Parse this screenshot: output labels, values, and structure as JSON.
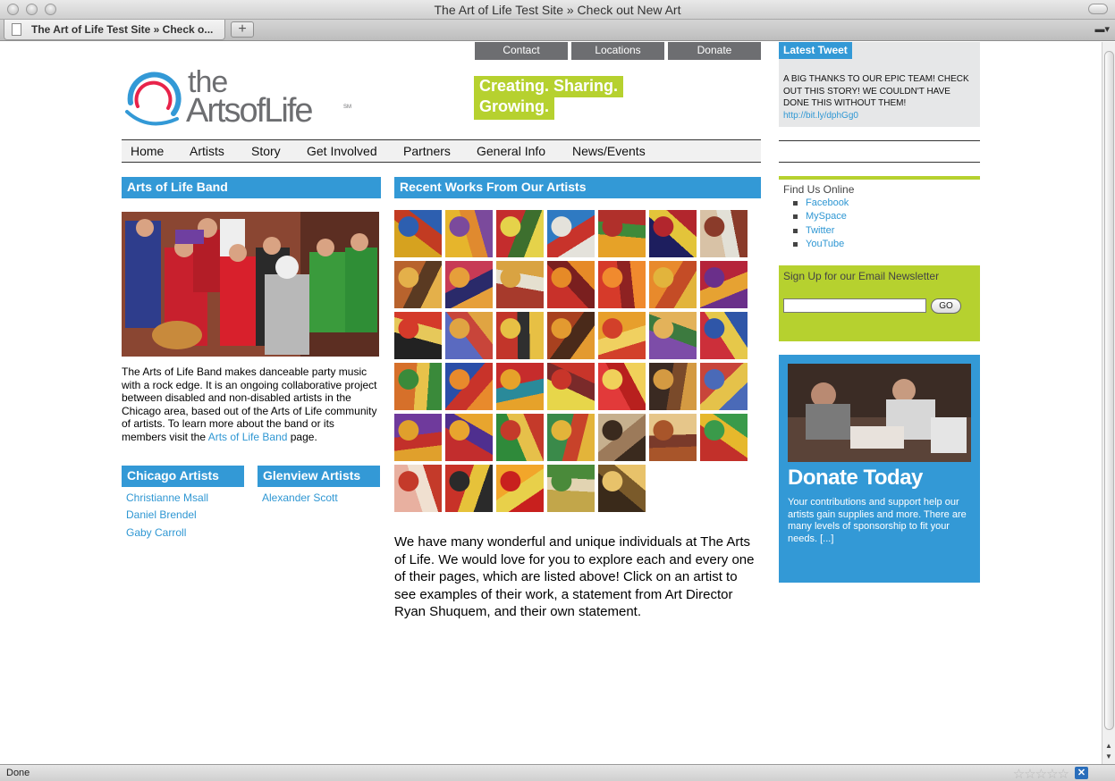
{
  "window": {
    "title": "The Art of Life Test Site » Check out New Art",
    "tab_title": "The Art of Life Test Site » Check o...",
    "new_tab": "+",
    "status": "Done"
  },
  "topnav": [
    "Contact",
    "Locations",
    "Donate"
  ],
  "logo": {
    "the": "the",
    "arts": "ArtsofLife",
    "sm": "SM"
  },
  "tagline": {
    "line1": "Creating. Sharing.",
    "line2": "Growing."
  },
  "mainnav": [
    "Home",
    "Artists",
    "Story",
    "Get Involved",
    "Partners",
    "General Info",
    "News/Events"
  ],
  "band": {
    "heading": "Arts of Life Band",
    "text_before": "The Arts of Life Band makes danceable party music with a rock edge. It is an ongoing collaborative project between disabled and non-disabled artists in the Chicago area, based out of the Arts of Life community of artists. To learn more about the band or its members visit the ",
    "link": "Arts of Life Band",
    "text_after": " page."
  },
  "chicago": {
    "heading": "Chicago Artists",
    "artists": [
      "Christianne Msall",
      "Daniel Brendel",
      "Gaby Carroll"
    ]
  },
  "glenview": {
    "heading": "Glenview Artists",
    "artists": [
      "Alexander Scott"
    ]
  },
  "recent": {
    "heading": "Recent Works From Our Artists"
  },
  "intro": "We have many wonderful and unique individuals at The Arts of Life. We would love for you to explore each and every one of their pages, which are listed above! Click on an artist to see examples of their work, a statement from Art Director Ryan Shuquem, and their own statement.",
  "tweet": {
    "heading": "Latest Tweet",
    "text": "A BIG THANKS TO OUR EPIC TEAM! CHECK OUT THIS STORY! WE COULDN'T HAVE DONE THIS WITHOUT THEM! ",
    "link": "http://bit.ly/dphGg0"
  },
  "findus": {
    "heading": "Find Us Online",
    "links": [
      "Facebook",
      "MySpace",
      "Twitter",
      "YouTube"
    ]
  },
  "newsletter": {
    "heading": "Sign Up for our Email Newsletter",
    "input_value": "",
    "button": "GO"
  },
  "donate": {
    "title": "Donate Today",
    "text": "Your contributions and support help our artists gain supplies and more. There are many levels of sponsorship to fit your needs. ",
    "more": "[...]"
  },
  "colors": {
    "accent_blue": "#3399d6",
    "accent_green": "#b6d12f",
    "nav_gray": "#6d6e71",
    "link": "#2f97d3"
  }
}
